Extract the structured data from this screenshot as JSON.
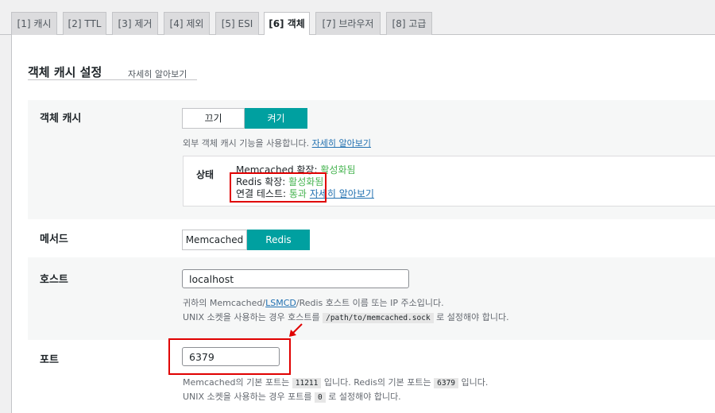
{
  "tabs": [
    {
      "label": "[1] 캐시"
    },
    {
      "label": "[2] TTL"
    },
    {
      "label": "[3] 제거"
    },
    {
      "label": "[4] 제외"
    },
    {
      "label": "[5] ESI"
    },
    {
      "label": "[6] 객체"
    },
    {
      "label": "[7] 브라우저"
    },
    {
      "label": "[8] 고급"
    }
  ],
  "page": {
    "title": "객체 캐시 설정",
    "learn_more": "자세히 알아보기"
  },
  "object_cache": {
    "label": "객체 캐시",
    "off_label": "끄기",
    "on_label": "켜기",
    "desc_prefix": "외부 객체 캐시 기능을 사용합니다.",
    "desc_link": "자세히 알아보기",
    "status_label": "상태",
    "memcached_ext_label": "Memcached 확장:",
    "memcached_ext_value": "활성화됨",
    "redis_ext_label": "Redis 확장:",
    "redis_ext_value": "활성화됨",
    "conn_test_label": "연결 테스트:",
    "conn_test_value": "통과",
    "conn_test_link": "자세히 알아보기"
  },
  "method": {
    "label": "메서드",
    "memcached_label": "Memcached",
    "redis_label": "Redis"
  },
  "host": {
    "label": "호스트",
    "value": "localhost",
    "desc1_a": "귀하의 Memcached/",
    "desc1_link": "LSMCD",
    "desc1_b": "/Redis 호스트 이름 또는 IP 주소입니다.",
    "desc2_a": "UNIX 소켓을 사용하는 경우 호스트를",
    "desc2_code": "/path/to/memcached.sock",
    "desc2_b": "로 설정해야 합니다."
  },
  "port": {
    "label": "포트",
    "value": "6379",
    "desc1_a": "Memcached의 기본 포트는",
    "desc1_code1": "11211",
    "desc1_b": "입니다. Redis의 기본 포트는",
    "desc1_code2": "6379",
    "desc1_c": "입니다.",
    "desc2_a": "UNIX 소켓을 사용하는 경우 포트를",
    "desc2_code": "0",
    "desc2_b": "로 설정해야 합니다."
  },
  "colors": {
    "accent": "#00a0a0",
    "highlight": "#e00000",
    "success": "#46b450",
    "link": "#2271b1"
  }
}
